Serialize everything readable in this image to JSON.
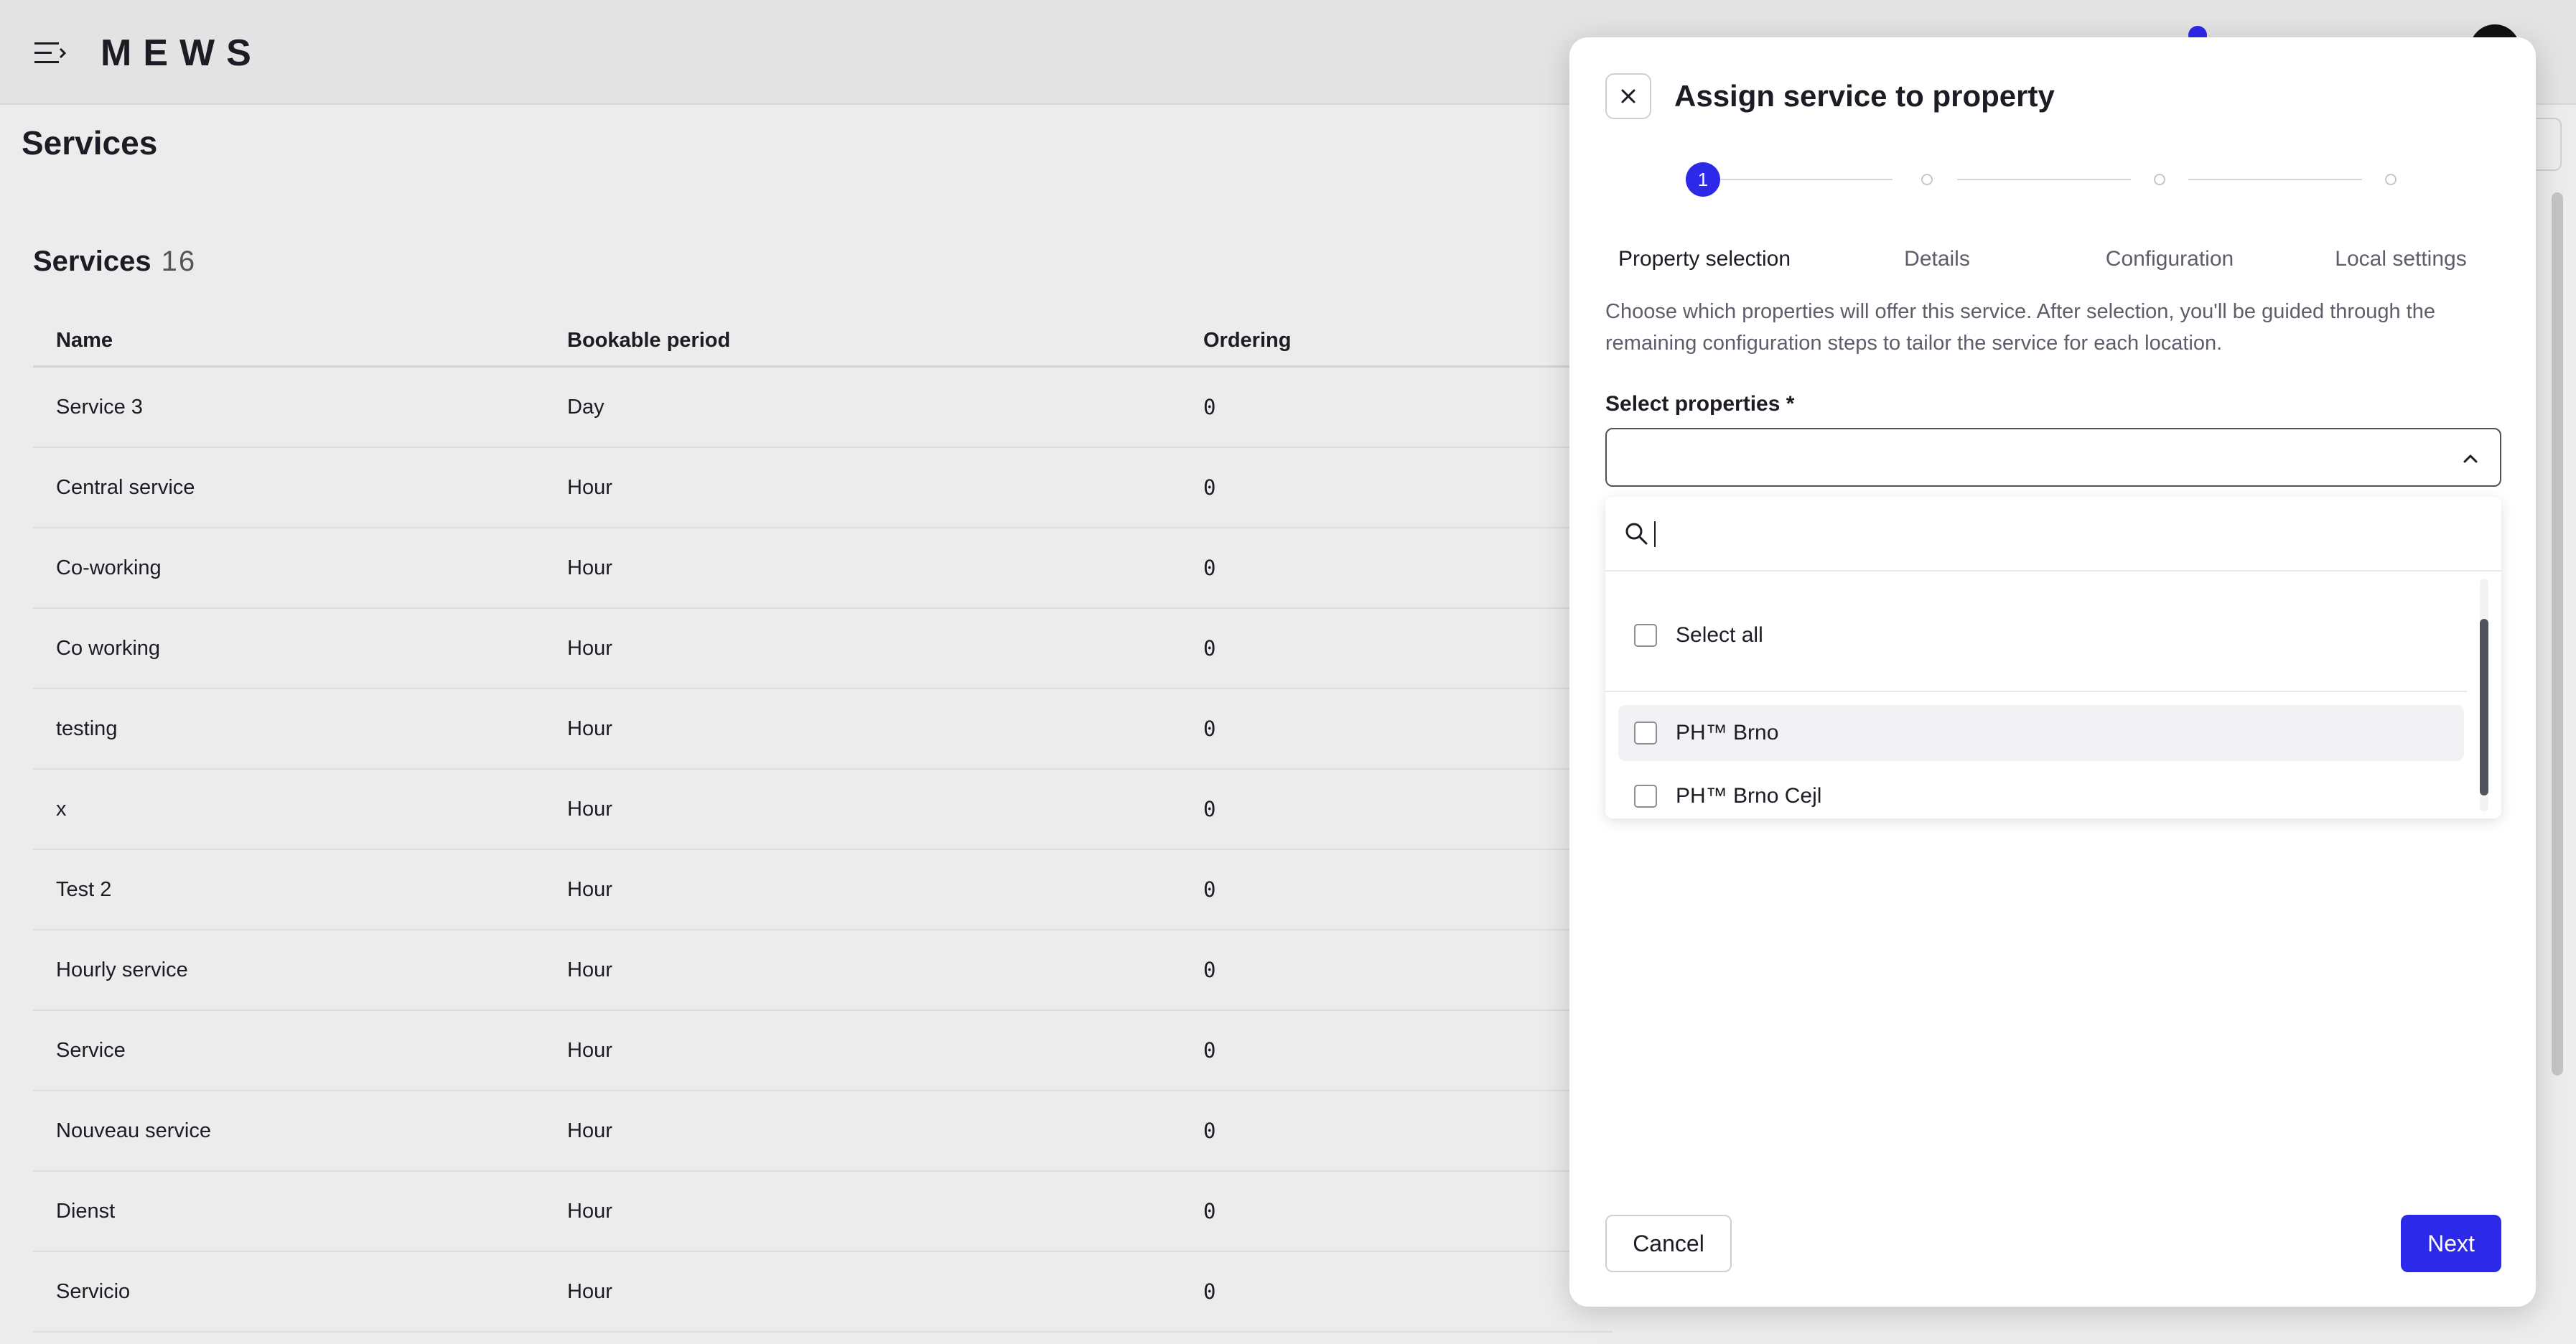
{
  "app": {
    "logo": "MEWS",
    "page_title": "Services"
  },
  "services": {
    "title": "Services",
    "count": "16",
    "columns": [
      "Name",
      "Bookable period",
      "Ordering"
    ],
    "rows": [
      {
        "name": "Service 3",
        "period": "Day",
        "ordering": "0"
      },
      {
        "name": "Central service",
        "period": "Hour",
        "ordering": "0"
      },
      {
        "name": "Co-working",
        "period": "Hour",
        "ordering": "0"
      },
      {
        "name": "Co working",
        "period": "Hour",
        "ordering": "0"
      },
      {
        "name": "testing",
        "period": "Hour",
        "ordering": "0"
      },
      {
        "name": "x",
        "period": "Hour",
        "ordering": "0"
      },
      {
        "name": "Test 2",
        "period": "Hour",
        "ordering": "0"
      },
      {
        "name": "Hourly service",
        "period": "Hour",
        "ordering": "0"
      },
      {
        "name": "Service",
        "period": "Hour",
        "ordering": "0"
      },
      {
        "name": "Nouveau service",
        "period": "Hour",
        "ordering": "0"
      },
      {
        "name": "Dienst",
        "period": "Hour",
        "ordering": "0"
      },
      {
        "name": "Servicio",
        "period": "Hour",
        "ordering": "0"
      }
    ]
  },
  "modal": {
    "title": "Assign service to property",
    "steps": [
      {
        "number": "1",
        "label": "Property selection"
      },
      {
        "label": "Details"
      },
      {
        "label": "Configuration"
      },
      {
        "label": "Local settings"
      }
    ],
    "description": "Choose which properties will offer this service. After selection, you'll be guided through the remaining configuration steps to tailor the service for each location.",
    "field_label": "Select properties *",
    "search_value": "",
    "select_all_label": "Select all",
    "options": [
      "PH™ Brno",
      "PH™ Brno Cejl"
    ],
    "cancel_label": "Cancel",
    "next_label": "Next"
  },
  "colors": {
    "accent": "#2d29e8",
    "text": "#1c1d24",
    "muted": "#5c5e6a"
  }
}
